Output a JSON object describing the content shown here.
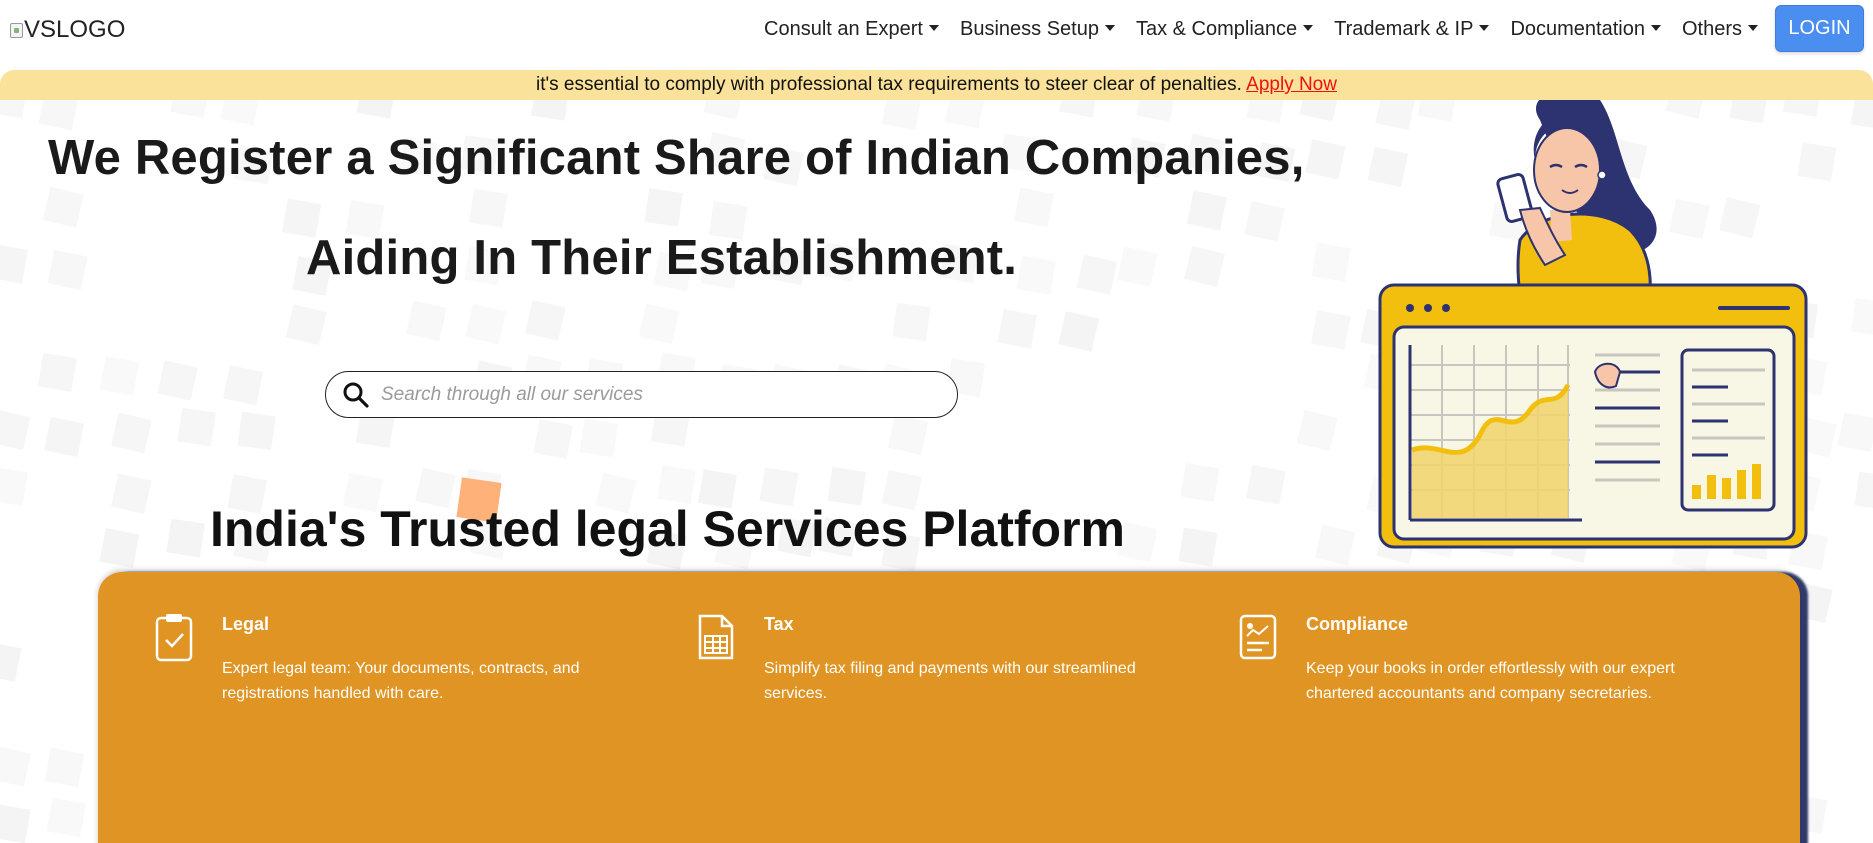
{
  "navbar": {
    "logo_alt": "VSLOGO",
    "menu": [
      {
        "label": "Consult an Expert"
      },
      {
        "label": "Business Setup"
      },
      {
        "label": "Tax & Compliance"
      },
      {
        "label": "Trademark & IP"
      },
      {
        "label": "Documentation"
      },
      {
        "label": "Others"
      }
    ],
    "login_label": "LOGIN"
  },
  "announcement": {
    "text": "it's essential to comply with professional tax requirements to steer clear of penalties.",
    "link_label": "Apply Now"
  },
  "hero": {
    "headline_line1": "We Register a Significant Share of Indian Companies,",
    "headline_line2": "Aiding In Their Establishment.",
    "search_placeholder": "Search through all our services",
    "tagline": "India's Trusted legal Services Platform"
  },
  "services": [
    {
      "title": "Legal",
      "description": "Expert legal team: Your documents, contracts, and registrations handled with care.",
      "icon": "clipboard-check-icon"
    },
    {
      "title": "Tax",
      "description": "Simplify tax filing and payments with our streamlined services.",
      "icon": "tax-document-icon"
    },
    {
      "title": "Compliance",
      "description": "Keep your books in order effortlessly with our expert chartered accountants and company secretaries.",
      "icon": "report-document-icon"
    }
  ],
  "colors": {
    "login_button": "#4a8ef0",
    "announcement_bg": "#fbe29b",
    "link_red": "#e11111",
    "card_orange": "#df9423",
    "accent_yellow": "#f2bf0e",
    "deco_square": "#ffa86b"
  }
}
